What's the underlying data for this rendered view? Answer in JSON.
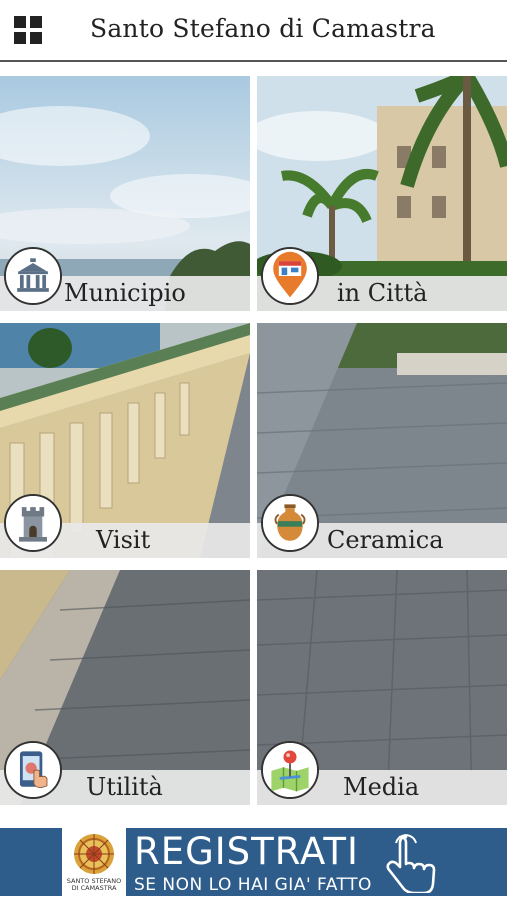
{
  "header": {
    "title": "Santo Stefano di Camastra",
    "menu_icon": "grid-menu-icon"
  },
  "tiles": [
    {
      "label": "Municipio",
      "icon": "town-hall-icon"
    },
    {
      "label": "in Città",
      "icon": "shop-pin-icon"
    },
    {
      "label": "Visit",
      "icon": "tower-icon"
    },
    {
      "label": "Ceramica",
      "icon": "vase-icon"
    },
    {
      "label": "Utilità",
      "icon": "phone-touch-icon"
    },
    {
      "label": "Media",
      "icon": "map-pin-icon"
    }
  ],
  "banner": {
    "main": "REGISTRATI",
    "sub": "SE NON LO HAI GIA' FATTO",
    "logo_caption_1": "SANTO STEFANO",
    "logo_caption_2": "DI CAMASTRA",
    "color": "#2e5d8c"
  }
}
